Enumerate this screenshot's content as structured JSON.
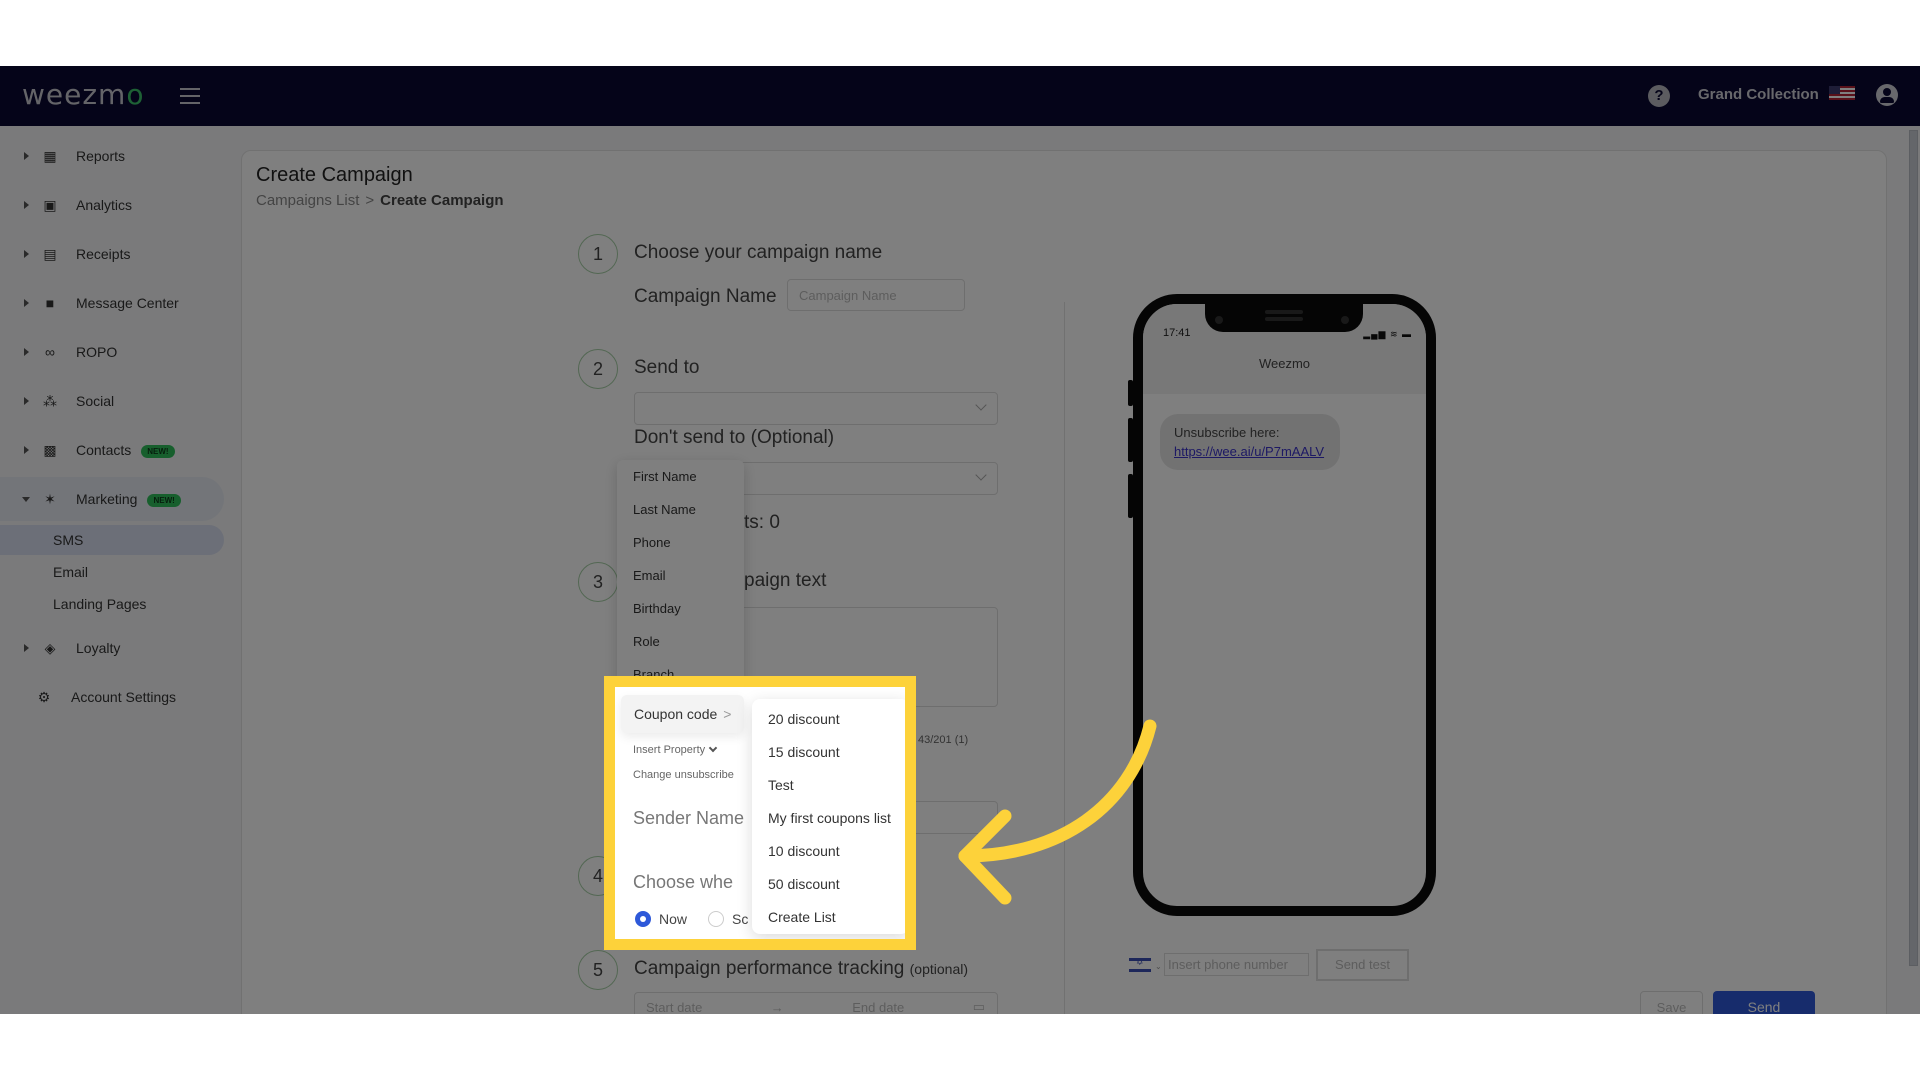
{
  "header": {
    "logo_text": "weezm",
    "logo_accent": "o",
    "account_name": "Grand Collection",
    "help_label": "?",
    "colors": {
      "bar": "#0a0933",
      "accent": "#2e59d9",
      "highlight": "#fdd23a",
      "badge": "#2fbf5a"
    }
  },
  "sidebar": {
    "items": [
      {
        "label": "Reports",
        "icon": "dashboard-icon"
      },
      {
        "label": "Analytics",
        "icon": "analytics-icon"
      },
      {
        "label": "Receipts",
        "icon": "receipt-icon"
      },
      {
        "label": "Message Center",
        "icon": "chat-icon"
      },
      {
        "label": "ROPO",
        "icon": "infinity-icon"
      },
      {
        "label": "Social",
        "icon": "people-icon"
      },
      {
        "label": "Contacts",
        "icon": "contacts-icon",
        "badge": "NEW!"
      },
      {
        "label": "Marketing",
        "icon": "party-popper-icon",
        "badge": "NEW!"
      },
      {
        "label": "Loyalty",
        "icon": "tag-icon"
      },
      {
        "label": "Account Settings",
        "icon": "gear-icon"
      }
    ],
    "marketing_sub": [
      "SMS",
      "Email",
      "Landing Pages"
    ],
    "active_sub": "SMS"
  },
  "page": {
    "title": "Create Campaign",
    "breadcrumb": {
      "parent": "Campaigns List",
      "sep": ">",
      "current": "Create Campaign"
    }
  },
  "form": {
    "step1": {
      "num": "1",
      "title": "Choose your campaign name",
      "label": "Campaign Name",
      "placeholder": "Campaign Name",
      "value": ""
    },
    "step2": {
      "num": "2",
      "title": "Send to",
      "dont_send": "Don't send to (Optional)",
      "recipients_partial": "ts: 0"
    },
    "step3": {
      "num": "3",
      "title_partial": "paign text",
      "insert_property": "Insert Property",
      "change_unsub": "Change unsubscribe",
      "counter_partial": "S",
      "counter": "43/201 (1)",
      "sender_name": "Sender Name"
    },
    "step4": {
      "num": "4",
      "title_partial": "Choose whe",
      "radio_now": "Now",
      "radio_schedule_partial": "Sc",
      "selected": "Now"
    },
    "step5": {
      "num": "5",
      "title": "Campaign performance tracking",
      "optional": "(optional)",
      "start_placeholder": "Start date",
      "end_placeholder": "End date",
      "arrow": "→"
    }
  },
  "property_menu": {
    "items": [
      "First Name",
      "Last Name",
      "Phone",
      "Email",
      "Birthday",
      "Role",
      "Branch"
    ],
    "coupon_trigger": "Coupon code",
    "coupon_trigger_chevron": ">"
  },
  "coupon_submenu": {
    "items": [
      "20 discount",
      "15 discount",
      "Test",
      "My first coupons list",
      "10 discount",
      "50 discount",
      "Create List"
    ]
  },
  "preview": {
    "time": "17:41",
    "status": "▂▄▆ ≋ ▬",
    "sender": "Weezmo",
    "message_text": "Unsubscribe here:",
    "message_link": "https://wee.ai/u/P7mAALV"
  },
  "test_send": {
    "phone_placeholder": "Insert phone number",
    "send_test_label": "Send test",
    "flag_chevron": "⌄"
  },
  "actions": {
    "save_label": "Save",
    "send_label": "Send"
  }
}
